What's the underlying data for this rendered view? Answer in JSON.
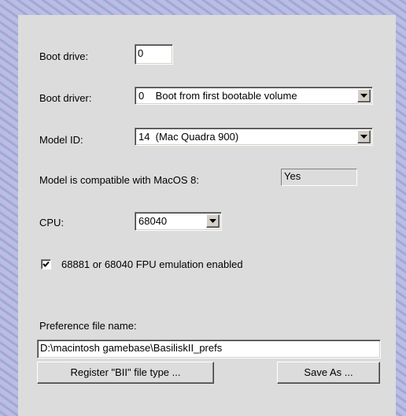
{
  "boot_drive": {
    "label": "Boot drive:",
    "value": "0"
  },
  "boot_driver": {
    "label": "Boot driver:",
    "value": "0    Boot from first bootable volume"
  },
  "model_id": {
    "label": "Model ID:",
    "value": "14  (Mac Quadra 900)"
  },
  "compat": {
    "label": "Model is compatible with MacOS 8:",
    "value": "Yes"
  },
  "cpu": {
    "label": "CPU:",
    "value": "68040"
  },
  "fpu": {
    "label": "68881 or 68040 FPU emulation enabled",
    "checked": true
  },
  "prefs": {
    "label": "Preference file name:",
    "value": "D:\\macintosh gamebase\\BasiliskII_prefs"
  },
  "buttons": {
    "register": "Register \"BII\" file type ...",
    "save_as": "Save As ..."
  },
  "icons": {
    "dropdown": "chevron-down-icon",
    "check": "checkmark-icon"
  }
}
